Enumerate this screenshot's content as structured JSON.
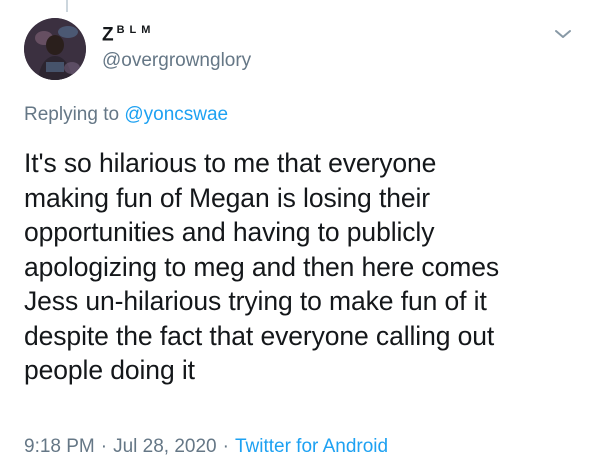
{
  "tweet": {
    "author": {
      "display_name_big": "Z",
      "display_name_small": "BLM",
      "handle": "@overgrownglory"
    },
    "reply": {
      "prefix": "Replying to ",
      "to_handle": "@yoncswae"
    },
    "text": "It's so hilarious to me that everyone\nmaking fun of Megan is losing their\nopportunities and having to publicly\napologizing to meg and then here comes\nJess un-hilarious trying to make fun of it\ndespite the fact that everyone calling out\npeople doing it",
    "time": "9:18 PM",
    "separator": "·",
    "date": "Jul 28, 2020",
    "source": "Twitter for Android"
  },
  "colors": {
    "text": "#14171a",
    "secondary": "#657786",
    "link": "#1da1f2"
  },
  "icons": {
    "menu": "chevron-down-icon"
  }
}
